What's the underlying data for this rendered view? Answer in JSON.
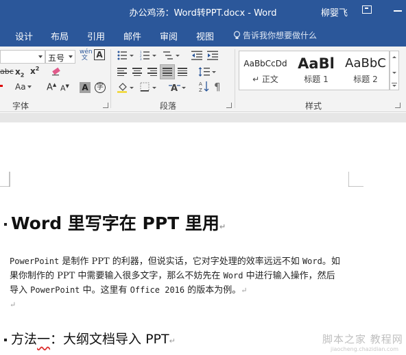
{
  "window": {
    "title": "办公鸡汤：Word转PPT.docx - Word",
    "user": "柳婴飞"
  },
  "ribbon_tabs": [
    "设计",
    "布局",
    "引用",
    "邮件",
    "审阅",
    "视图"
  ],
  "tell_me": "告诉我你想要做什么",
  "font_group": {
    "label": "字体",
    "font_size": "五号",
    "buttons": [
      "abc",
      "x₂",
      "x²",
      "Aa",
      "A",
      "A",
      "A",
      "字",
      "wén 文",
      "A"
    ]
  },
  "paragraph_group": {
    "label": "段落"
  },
  "styles_group": {
    "label": "样式",
    "styles": [
      {
        "sample": "AaBbCcDd",
        "name": "↵ 正文"
      },
      {
        "sample": "AaBl",
        "name": "标题 1"
      },
      {
        "sample": "AaBbC",
        "name": "标题 2"
      }
    ]
  },
  "document": {
    "heading": "Word 里写字在 PPT 里用",
    "paragraph_lines": [
      [
        "PowerPoint",
        " 是制作 PPT 的利器，但说实话，它对字处理的效率远远不如 ",
        "Word",
        "。如"
      ],
      [
        "果你制作的 PPT 中需要输入很多文字，那么不妨先在 ",
        "Word",
        " 中进行输入操作，然后"
      ],
      [
        "导入 ",
        "PowerPoint",
        " 中。这里有 ",
        "Office 2016",
        " 的版本为例。"
      ]
    ],
    "subheading_prefix": "方法",
    "subheading_underlined": "一",
    "subheading_rest": "：大纲文档导入 PPT",
    "paragraph_mark": "↵"
  },
  "watermark": {
    "text": "脚本之家 教程网",
    "url": "jiaocheng.chazidian.com"
  },
  "colors": {
    "brand": "#2b579a",
    "ribbon_bg": "#f3f3f3"
  }
}
